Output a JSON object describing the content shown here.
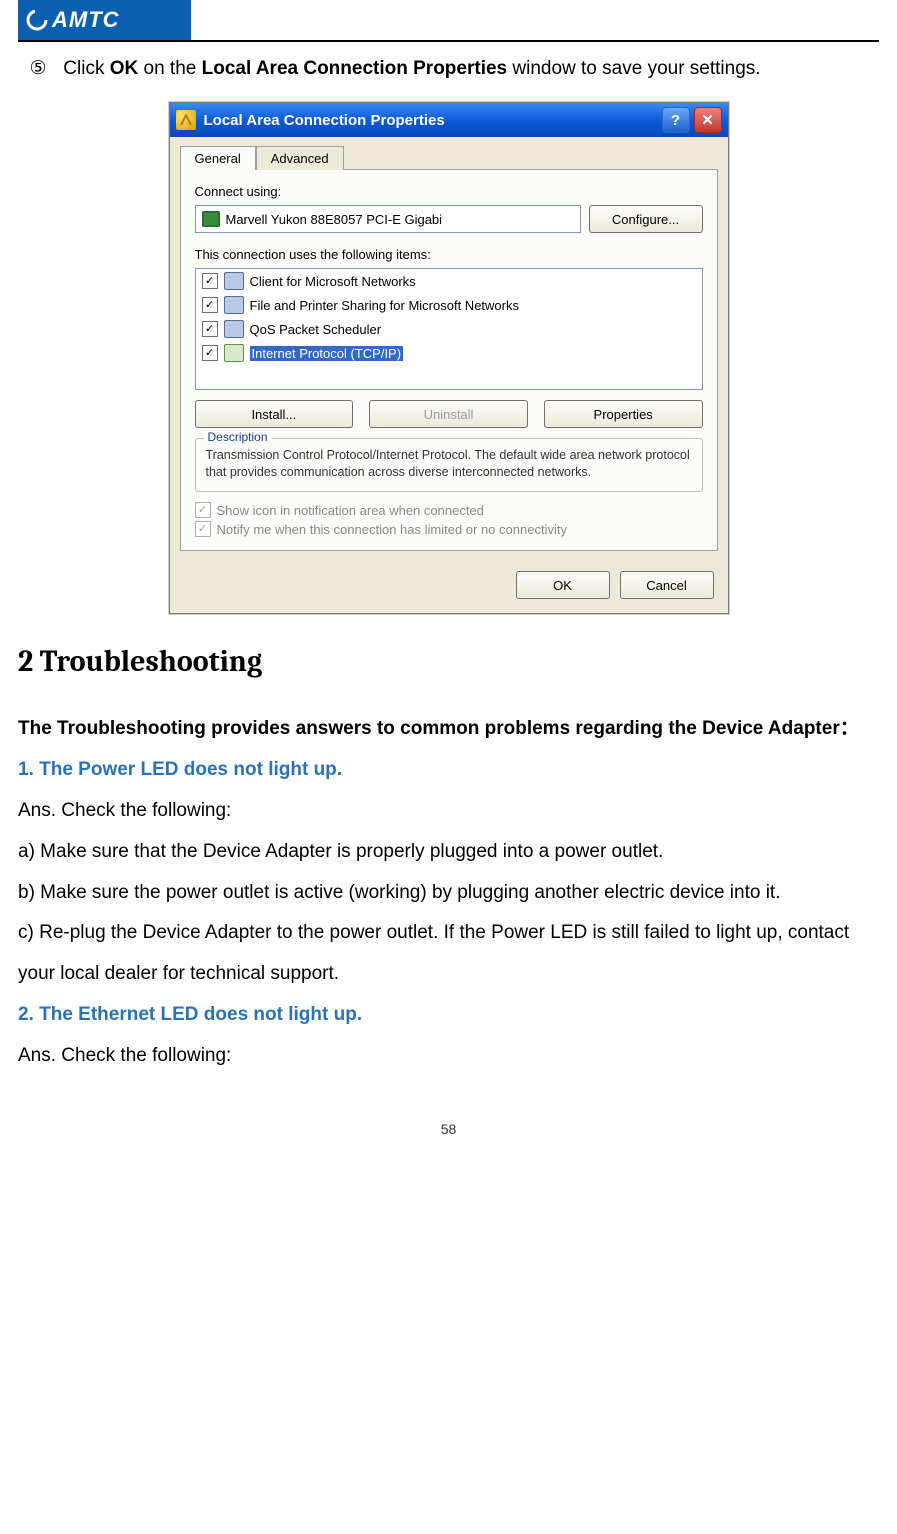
{
  "brand": "AMTC",
  "step_number": "⑤",
  "step_prefix": "Click ",
  "step_ok": "OK",
  "step_mid": " on the ",
  "step_window_name": "Local Area Connection Properties",
  "step_suffix": " window to save your settings.",
  "dialog": {
    "title": "Local Area Connection Properties",
    "help_glyph": "?",
    "close_glyph": "✕",
    "tab_general": "General",
    "tab_advanced": "Advanced",
    "connect_using_label": "Connect using:",
    "adapter_name": "Marvell Yukon 88E8057 PCI-E Gigabi",
    "configure_btn": "Configure...",
    "items_label": "This connection uses the following items:",
    "items": [
      {
        "label": "Client for Microsoft Networks"
      },
      {
        "label": "File and Printer Sharing for Microsoft Networks"
      },
      {
        "label": "QoS Packet Scheduler"
      },
      {
        "label": "Internet Protocol (TCP/IP)"
      }
    ],
    "install_btn": "Install...",
    "uninstall_btn": "Uninstall",
    "properties_btn": "Properties",
    "desc_legend": "Description",
    "desc_text": "Transmission Control Protocol/Internet Protocol. The default wide area network protocol that provides communication across diverse interconnected networks.",
    "chk_show_icon": "Show icon in notification area when connected",
    "chk_notify": "Notify me when this connection has limited or no connectivity",
    "ok_btn": "OK",
    "cancel_btn": "Cancel"
  },
  "section_heading": "2 Troubleshooting",
  "intro": "The Troubleshooting provides answers to common problems regarding the Device Adapter：",
  "q1": "1. The Power LED does not light up.",
  "a_label": "Ans. Check the following:",
  "q1_a": "a) Make sure that the Device Adapter is properly plugged into a power outlet.",
  "q1_b": "b) Make sure the power outlet is active (working) by plugging another electric device into it.",
  "q1_c": "c) Re-plug the Device Adapter to the power outlet. If the Power LED is still failed to light up, contact your local dealer for technical support.",
  "q2": "2. The Ethernet LED does not light up.",
  "a_label2": "Ans. Check the following:",
  "page_number": "58"
}
